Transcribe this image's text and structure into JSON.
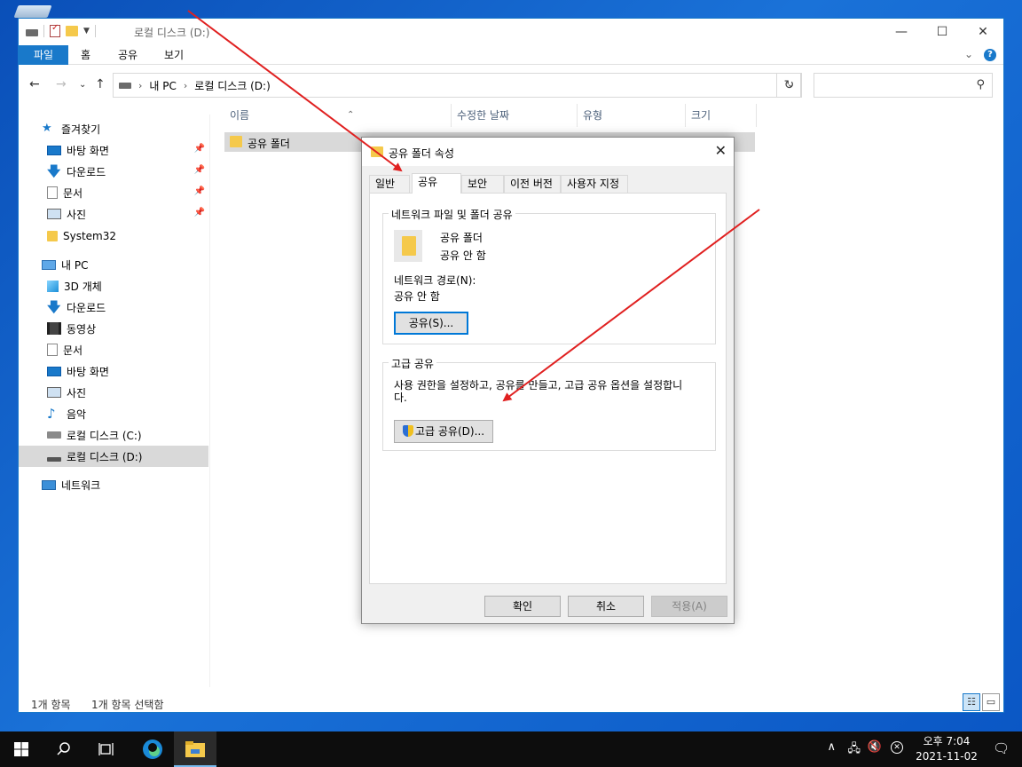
{
  "explorer": {
    "title": "로컬 디스크 (D:)",
    "ribbon_tabs": [
      "파일",
      "홈",
      "공유",
      "보기"
    ],
    "address": [
      "내 PC",
      "로컬 디스크 (D:)"
    ],
    "search_placeholder": "",
    "sidebar": {
      "quick_access": "즐겨찾기",
      "quick_items": [
        "바탕 화면",
        "다운로드",
        "문서",
        "사진",
        "System32"
      ],
      "this_pc": "내 PC",
      "pc_items": [
        "3D 개체",
        "다운로드",
        "동영상",
        "문서",
        "바탕 화면",
        "사진",
        "음악",
        "로컬 디스크 (C:)",
        "로컬 디스크 (D:)"
      ],
      "network": "네트워크"
    },
    "columns": [
      "이름",
      "수정한 날짜",
      "유형",
      "크기"
    ],
    "files": [
      {
        "name": "공유 폴더"
      }
    ],
    "status": {
      "count": "1개 항목",
      "selected": "1개 항목 선택함"
    }
  },
  "dialog": {
    "title": "공유 폴더 속성",
    "tabs": [
      "일반",
      "공유",
      "보안",
      "이전 버전",
      "사용자 지정"
    ],
    "active_tab": "공유",
    "network_group": {
      "legend": "네트워크 파일 및 폴더 공유",
      "folder_name": "공유 폴더",
      "share_state": "공유 안 함",
      "path_label": "네트워크 경로(N):",
      "path_value": "공유 안 함",
      "share_button": "공유(S)..."
    },
    "advanced_group": {
      "legend": "고급 공유",
      "description_line1": "사용 권한을 설정하고, 공유를 만들고, 고급 공유 옵션을 설정합니",
      "description_line2": "다.",
      "advanced_button": "고급 공유(D)..."
    },
    "buttons": {
      "ok": "확인",
      "cancel": "취소",
      "apply": "적용(A)"
    }
  },
  "taskbar": {
    "time": "오후 7:04",
    "date": "2021-11-02"
  },
  "colors": {
    "accent": "#1979ca",
    "arrow": "#e02020",
    "desktop": "#0a56c4"
  }
}
